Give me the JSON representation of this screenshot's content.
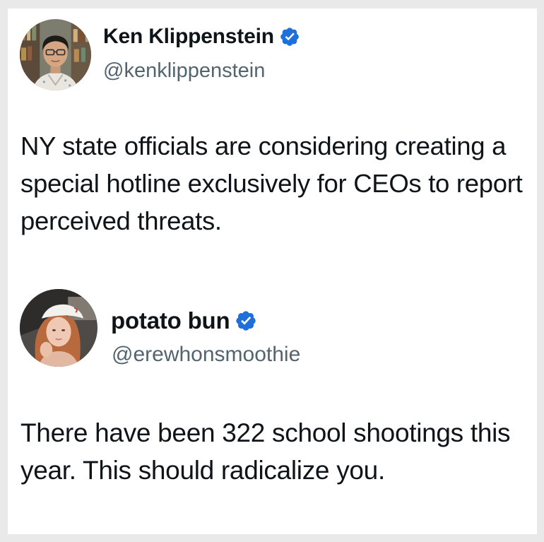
{
  "tweets": [
    {
      "author": {
        "name": "Ken Klippenstein",
        "handle": "@kenklippenstein",
        "verified": true,
        "avatar_icon": "avatar-photo-man"
      },
      "text": "NY state officials are considering creating a special hotline exclusively for CEOs to report perceived threats."
    },
    {
      "author": {
        "name": "potato bun",
        "handle": "@erewhonsmoothie",
        "verified": true,
        "avatar_icon": "avatar-photo-woman-cap"
      },
      "text": "There have been 322 school shootings this year. This should radicalize you."
    }
  ],
  "colors": {
    "verified_badge": "#1d6fdc",
    "name": "#0f1419",
    "handle": "#536471",
    "background": "#ffffff",
    "page": "#e9e9e9"
  }
}
